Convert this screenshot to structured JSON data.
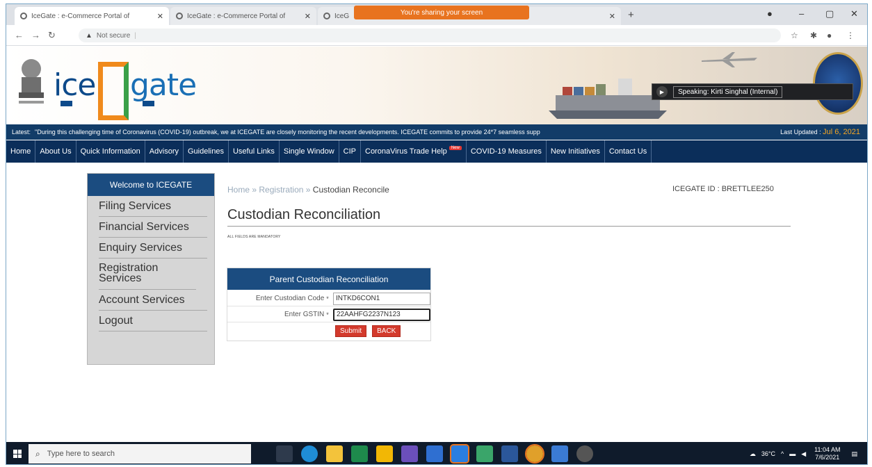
{
  "browser": {
    "tabs": [
      {
        "title": "IceGate : e-Commerce Portal of"
      },
      {
        "title": "IceGate : e-Commerce Portal of"
      },
      {
        "title": "IceG"
      }
    ],
    "share_banner": "You're sharing your screen",
    "address": {
      "security": "Not secure",
      "url": ""
    }
  },
  "header": {
    "logo_ice": "ice",
    "logo_gate": "gate",
    "speaker_text": "Speaking: Kirti Singhal (Internal)"
  },
  "ticker": {
    "latest_label": "Latest:",
    "message": "\"During this challenging time of Coronavirus (COVID-19) outbreak, we at ICEGATE are closely monitoring the recent developments. ICEGATE commits to provide 24*7 seamless supp",
    "updated_label": "Last Updated :",
    "updated_date": "Jul 6, 2021"
  },
  "nav": {
    "items": [
      {
        "label": "Home"
      },
      {
        "label": "About Us"
      },
      {
        "label": "Quick Information"
      },
      {
        "label": "Advisory"
      },
      {
        "label": "Guidelines"
      },
      {
        "label": "Useful Links"
      },
      {
        "label": "Single Window"
      },
      {
        "label": "CIP"
      },
      {
        "label": "CoronaVirus Trade Help"
      },
      {
        "label": "COVID-19 Measures"
      },
      {
        "label": "New Initiatives"
      },
      {
        "label": "Contact Us"
      }
    ],
    "new_badge": "New"
  },
  "sidebar": {
    "heading": "Welcome to ICEGATE",
    "items": [
      {
        "label": "Filing Services"
      },
      {
        "label": "Financial Services"
      },
      {
        "label": "Enquiry Services"
      },
      {
        "label": "Registration Services"
      },
      {
        "label": "Account Services"
      },
      {
        "label": "Logout"
      }
    ]
  },
  "breadcrumb": {
    "home": "Home",
    "sep": "»",
    "registration": "Registration",
    "current": "Custodian Reconcile"
  },
  "icegate_id": "ICEGATE ID : BRETTLEE250",
  "page": {
    "title": "Custodian Reconciliation",
    "mandatory_note": "ALL FIELDS ARE MANDATORY"
  },
  "form": {
    "heading": "Parent Custodian Reconciliation",
    "custodian_code_label": "Enter Custodian Code",
    "custodian_code_value": "INTKD6CON1",
    "gstin_label": "Enter GSTIN",
    "gstin_value": "22AAHFG2237N123",
    "required_mark": "*",
    "submit_label": "Submit",
    "back_label": "BACK"
  },
  "taskbar": {
    "search_placeholder": "Type here to search",
    "temperature": "36°C",
    "time": "11:04 AM",
    "date": "7/6/2021"
  },
  "colors": {
    "nav_bg": "#0b2e5a",
    "ticker_bg": "#123c68",
    "panel_head": "#1b4c80",
    "button_red": "#d33a2c",
    "accent_orange": "#e8731f"
  }
}
